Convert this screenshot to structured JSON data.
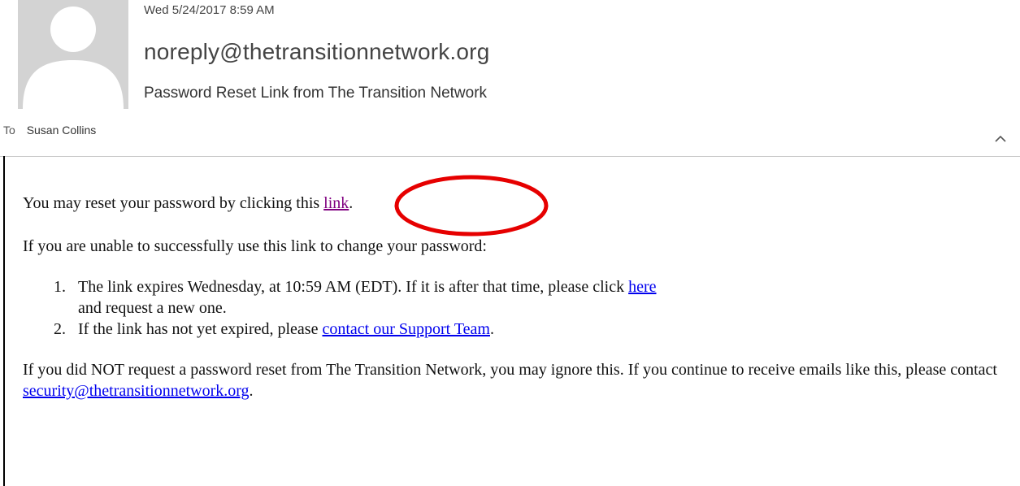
{
  "header": {
    "date": "Wed 5/24/2017 8:59 AM",
    "sender": "noreply@thetransitionnetwork.org",
    "subject": "Password Reset Link from The Transition Network",
    "to_label": "To",
    "to_name": "Susan Collins",
    "collapse_icon": "chevron-up-icon"
  },
  "email": {
    "p1_text": "You may reset your password by clicking this ",
    "p1_link": "link",
    "p1_end": ".",
    "p2": "If you are unable to successfully use this link to change your password:",
    "items": [
      {
        "text": "The link expires Wednesday, at 10:59 AM (EDT).  If it is after that time, please click ",
        "link": "here",
        "end": " and request a new one."
      },
      {
        "text": "If the link has not yet expired, please ",
        "link": "contact our Support Team",
        "end": "."
      }
    ],
    "p3_text": "If you did NOT request a password reset from The Transition Network, you may ignore this.  If you continue to receive emails like this, please contact ",
    "p3_link": "security@thetransitionnetwork.org",
    "p3_end": "."
  },
  "colors": {
    "link": "#0000ee",
    "visited_link": "#800080",
    "annotation": "#e60000"
  }
}
